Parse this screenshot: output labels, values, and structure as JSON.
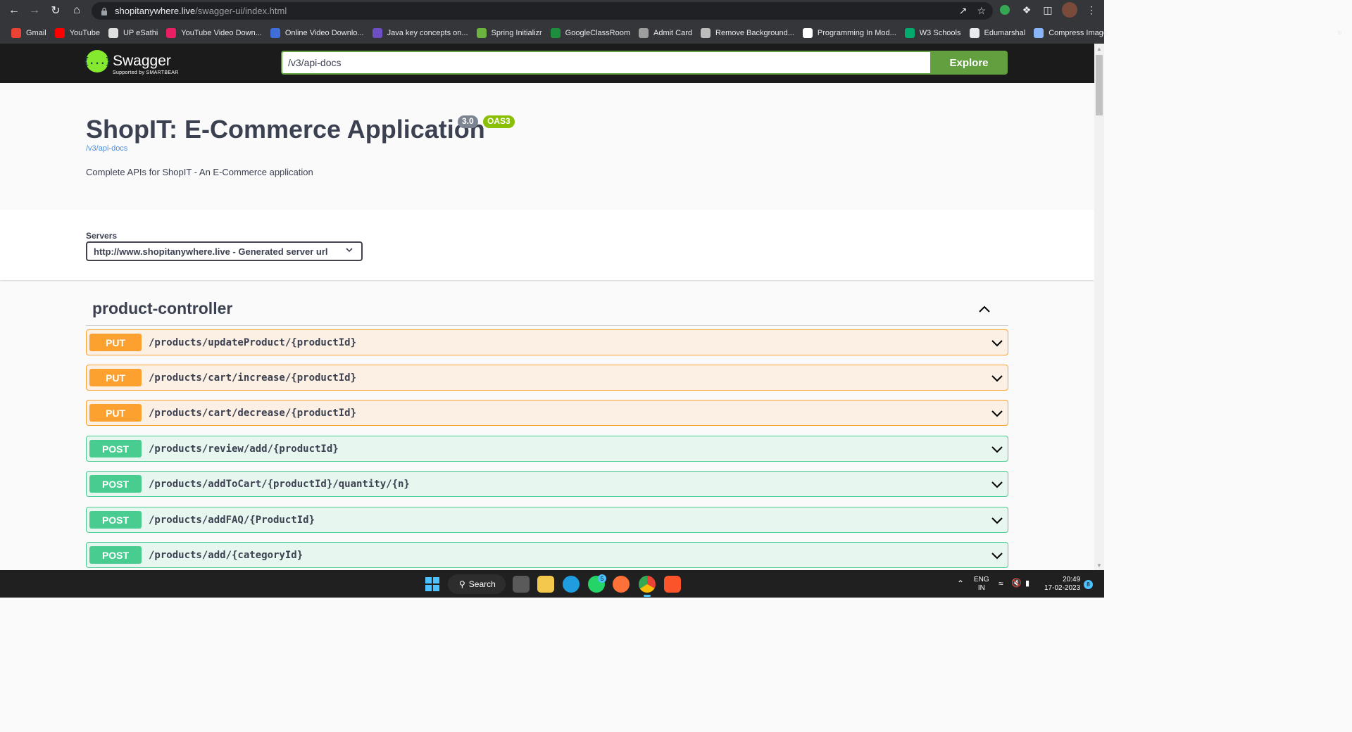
{
  "browser": {
    "url_host": "shopitanywhere.live",
    "url_path": "/swagger-ui/index.html",
    "bookmarks": [
      {
        "label": "Gmail",
        "color": "#ea4335"
      },
      {
        "label": "YouTube",
        "color": "#ff0000"
      },
      {
        "label": "UP eSathi",
        "color": "#e0e0e0"
      },
      {
        "label": "YouTube Video Down...",
        "color": "#e91e63"
      },
      {
        "label": "Online Video Downlo...",
        "color": "#3f6ed8"
      },
      {
        "label": "Java key concepts on...",
        "color": "#6d4fc3"
      },
      {
        "label": "Spring Initializr",
        "color": "#6db33f"
      },
      {
        "label": "GoogleClassRoom",
        "color": "#1e8e3e"
      },
      {
        "label": "Admit Card",
        "color": "#9e9e9e"
      },
      {
        "label": "Remove Background...",
        "color": "#bdbdbd"
      },
      {
        "label": "Programming In Mod...",
        "color": "#ffffff"
      },
      {
        "label": "W3 Schools",
        "color": "#04aa6d"
      },
      {
        "label": "Edumarshal",
        "color": "#e8eaed"
      },
      {
        "label": "Compress Image",
        "color": "#8ab4f8"
      }
    ]
  },
  "swagger": {
    "logo_name": "Swagger",
    "logo_sub": "Supported by SMARTBEAR",
    "logo_glyph": "{...}",
    "spec_url": "/v3/api-docs",
    "explore_label": "Explore"
  },
  "info": {
    "title": "ShopIT: E-Commerce Application",
    "version": "3.0",
    "oas": "OAS3",
    "spec_link": "/v3/api-docs",
    "description": "Complete APIs for ShopIT - An E-Commerce application"
  },
  "servers": {
    "label": "Servers",
    "selected": "http://www.shopitanywhere.live - Generated server url"
  },
  "controller": {
    "name": "product-controller",
    "operations": [
      {
        "method": "PUT",
        "path": "/products/updateProduct/{productId}"
      },
      {
        "method": "PUT",
        "path": "/products/cart/increase/{productId}"
      },
      {
        "method": "PUT",
        "path": "/products/cart/decrease/{productId}"
      },
      {
        "method": "POST",
        "path": "/products/review/add/{productId}"
      },
      {
        "method": "POST",
        "path": "/products/addToCart/{productId}/quantity/{n}"
      },
      {
        "method": "POST",
        "path": "/products/addFAQ/{ProductId}"
      },
      {
        "method": "POST",
        "path": "/products/add/{categoryId}"
      }
    ]
  },
  "taskbar": {
    "search_label": "Search",
    "lang_top": "ENG",
    "lang_bottom": "IN",
    "time": "20:49",
    "date": "17-02-2023",
    "notification_count": "8",
    "whatsapp_badge": "5"
  }
}
